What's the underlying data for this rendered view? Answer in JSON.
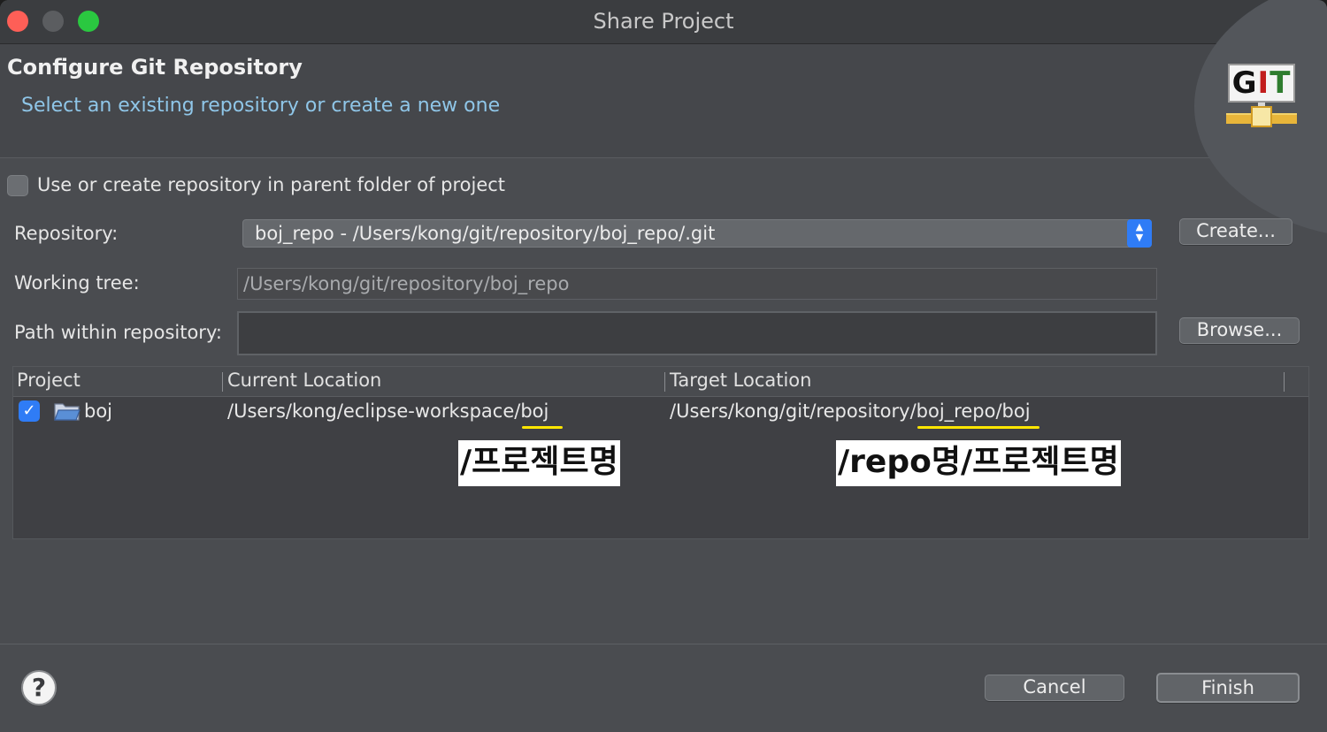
{
  "window": {
    "title": "Share Project"
  },
  "header": {
    "title": "Configure Git Repository",
    "subtitle": "Select an existing repository or create a new one",
    "logo_text": [
      "G",
      "I",
      "T"
    ]
  },
  "options": {
    "parent_folder_checkbox_label": "Use or create repository in parent folder of project",
    "parent_folder_checked": false
  },
  "form": {
    "repository_label": "Repository:",
    "repository_value": "boj_repo - /Users/kong/git/repository/boj_repo/.git",
    "create_button": "Create...",
    "working_tree_label": "Working tree:",
    "working_tree_value": "/Users/kong/git/repository/boj_repo",
    "path_label": "Path within repository:",
    "path_value": "",
    "browse_button": "Browse..."
  },
  "table": {
    "columns": [
      "Project",
      "Current Location",
      "Target Location"
    ],
    "rows": [
      {
        "checked": true,
        "project": "boj",
        "current_location": "/Users/kong/eclipse-workspace/boj",
        "target_location": "/Users/kong/git/repository/boj_repo/boj"
      }
    ]
  },
  "annotations": {
    "current_note": "/프로젝트명",
    "target_note": "/repo명/프로젝트명"
  },
  "footer": {
    "help_icon": "?",
    "cancel_button": "Cancel",
    "finish_button": "Finish"
  },
  "colors": {
    "accent": "#2f7cf6",
    "subtitle": "#8fc6e8",
    "highlight_underline": "#ffe600"
  }
}
